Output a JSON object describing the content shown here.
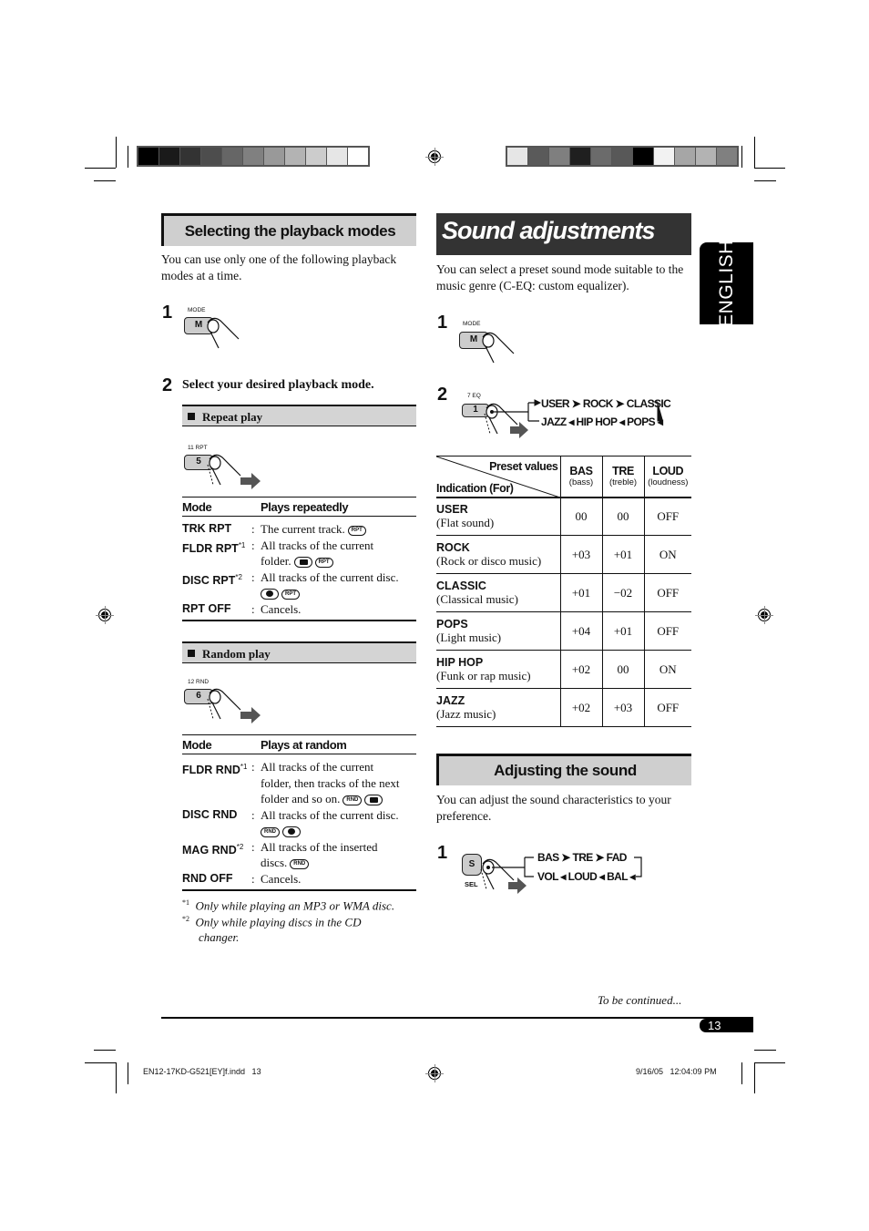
{
  "color_bars": {
    "left": [
      "#000000",
      "#1a1a1a",
      "#333333",
      "#4d4d4d",
      "#666666",
      "#808080",
      "#999999",
      "#b3b3b3",
      "#cccccc",
      "#e6e6e6",
      "#ffffff"
    ],
    "right": [
      "#e6e6e6",
      "#5a5a5a",
      "#7f7f7f",
      "#1f1f1f",
      "#6b6b6b",
      "#585858",
      "#000000",
      "#f2f2f2",
      "#a6a6a6",
      "#b3b3b3",
      "#808080"
    ]
  },
  "language_tab": "ENGLISH",
  "left": {
    "heading": "Selecting the playback modes",
    "intro": "You can use only one of the following playback modes at a time.",
    "step1": {
      "num": "1",
      "button_label": "MODE",
      "button_key": "M"
    },
    "step2": {
      "num": "2",
      "text": "Select your desired playback mode."
    },
    "repeat": {
      "title": "Repeat play",
      "button_label": "11 RPT",
      "button_key": "5",
      "col_mode": "Mode",
      "col_desc": "Plays repeatedly",
      "rows": [
        {
          "mode": "TRK RPT",
          "note": "",
          "desc": "The current track.",
          "desc2": "",
          "icons": [
            "RPT"
          ]
        },
        {
          "mode": "FLDR RPT",
          "note": "*1",
          "desc": "All tracks of the current",
          "desc2": "folder.",
          "icons": [
            "folder",
            "RPT"
          ]
        },
        {
          "mode": "DISC RPT",
          "note": "*2",
          "desc": "All tracks of the current disc.",
          "desc2": "",
          "icons": [
            "disc",
            "RPT"
          ]
        },
        {
          "mode": "RPT OFF",
          "note": "",
          "desc": "Cancels.",
          "desc2": "",
          "icons": []
        }
      ]
    },
    "random": {
      "title": "Random play",
      "button_label": "12 RND",
      "button_key": "6",
      "col_mode": "Mode",
      "col_desc": "Plays at random",
      "rows": [
        {
          "mode": "FLDR RND",
          "note": "*1",
          "desc": "All tracks of the current",
          "desc2": "folder, then tracks of the next",
          "desc3": "folder and so on.",
          "icons": [
            "RND",
            "folder"
          ]
        },
        {
          "mode": "DISC RND",
          "note": "",
          "desc": "All tracks of the current disc.",
          "icons": [
            "RND",
            "disc"
          ]
        },
        {
          "mode": "MAG RND",
          "note": "*2",
          "desc": "All tracks of the inserted",
          "desc2": "discs.",
          "icons": [
            "RND"
          ]
        },
        {
          "mode": "RND OFF",
          "note": "",
          "desc": "Cancels.",
          "icons": []
        }
      ]
    },
    "footnotes": [
      {
        "mark": "*1",
        "text": "Only while playing an MP3 or WMA disc."
      },
      {
        "mark": "*2",
        "text": "Only while playing discs in the CD",
        "text2": "changer."
      }
    ]
  },
  "right": {
    "heading": "Sound adjustments",
    "intro": "You can select a preset sound mode suitable to the music genre (C-EQ: custom equalizer).",
    "step1": {
      "num": "1",
      "button_label": "MODE",
      "button_key": "M"
    },
    "step2": {
      "num": "2",
      "button_label": "7 EQ",
      "button_key": "1",
      "flow_top": [
        "USER",
        "ROCK",
        "CLASSIC"
      ],
      "flow_bottom": [
        "JAZZ",
        "HIP HOP",
        "POPS"
      ]
    },
    "preset_table": {
      "corner_top": "Preset values",
      "corner_bottom": "Indication (For)",
      "columns": [
        {
          "name": "BAS",
          "sub": "(bass)"
        },
        {
          "name": "TRE",
          "sub": "(treble)"
        },
        {
          "name": "LOUD",
          "sub": "(loudness)"
        }
      ],
      "rows": [
        {
          "name": "USER",
          "desc": "(Flat sound)",
          "bas": "00",
          "tre": "00",
          "loud": "OFF"
        },
        {
          "name": "ROCK",
          "desc": "(Rock or disco music)",
          "bas": "+03",
          "tre": "+01",
          "loud": "ON"
        },
        {
          "name": "CLASSIC",
          "desc": "(Classical music)",
          "bas": "+01",
          "tre": "−02",
          "loud": "OFF"
        },
        {
          "name": "POPS",
          "desc": "(Light music)",
          "bas": "+04",
          "tre": "+01",
          "loud": "OFF"
        },
        {
          "name": "HIP HOP",
          "desc": "(Funk or rap music)",
          "bas": "+02",
          "tre": "00",
          "loud": "ON"
        },
        {
          "name": "JAZZ",
          "desc": "(Jazz music)",
          "bas": "+02",
          "tre": "+03",
          "loud": "OFF"
        }
      ]
    },
    "adjust": {
      "heading": "Adjusting the sound",
      "intro": "You can adjust the sound characteristics to your preference.",
      "step1": {
        "num": "1",
        "button_key": "S",
        "button_sub": "SEL",
        "flow_top": [
          "BAS",
          "TRE",
          "FAD"
        ],
        "flow_bottom": [
          "VOL",
          "LOUD",
          "BAL"
        ]
      }
    }
  },
  "footer": {
    "continued": "To be continued...",
    "page_number": "13",
    "file_info": "EN12-17KD-G521[EY]f.indd   13",
    "timestamp": "9/16/05   12:04:09 PM"
  }
}
